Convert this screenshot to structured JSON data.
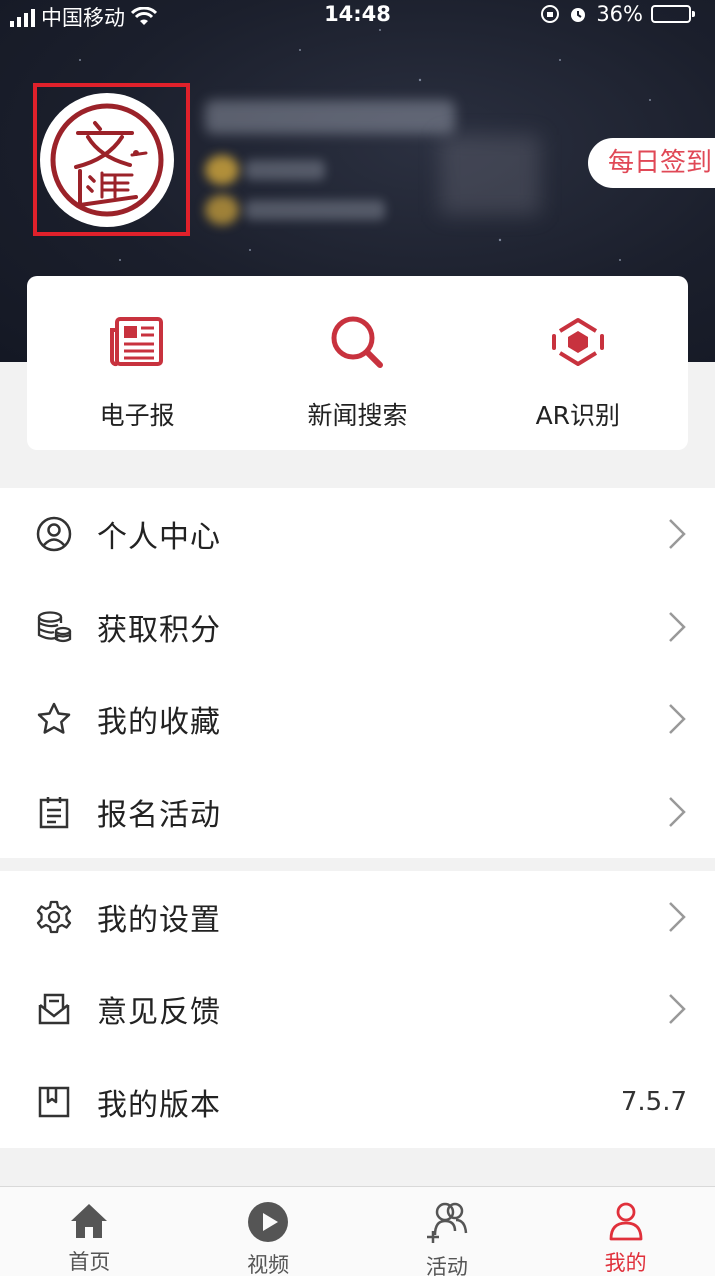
{
  "status_bar": {
    "carrier": "中国移动",
    "time": "14:48",
    "battery_percent": "36%",
    "battery_color": "#4cd964"
  },
  "header": {
    "avatar_icon": "wenhui-seal-logo",
    "checkin_label": "每日签到"
  },
  "quick_actions": [
    {
      "label": "电子报",
      "icon": "newspaper-icon"
    },
    {
      "label": "新闻搜索",
      "icon": "search-icon"
    },
    {
      "label": "AR识别",
      "icon": "ar-cube-icon"
    }
  ],
  "menu_group_1": [
    {
      "label": "个人中心",
      "icon": "user-circle-icon"
    },
    {
      "label": "获取积分",
      "icon": "coins-icon"
    },
    {
      "label": "我的收藏",
      "icon": "star-icon"
    },
    {
      "label": "报名活动",
      "icon": "clipboard-icon"
    }
  ],
  "menu_group_2": [
    {
      "label": "我的设置",
      "icon": "gear-icon"
    },
    {
      "label": "意见反馈",
      "icon": "feedback-mail-icon"
    },
    {
      "label": "我的版本",
      "icon": "book-icon",
      "value": "7.5.7"
    }
  ],
  "tabbar": {
    "items": [
      {
        "label": "首页",
        "icon": "home-icon"
      },
      {
        "label": "视频",
        "icon": "play-icon"
      },
      {
        "label": "活动",
        "icon": "people-add-icon"
      },
      {
        "label": "我的",
        "icon": "user-icon",
        "active": true
      }
    ]
  },
  "colors": {
    "accent": "#c8323e",
    "active_tab": "#e0303b",
    "header_bg": "#1b1f2c"
  }
}
